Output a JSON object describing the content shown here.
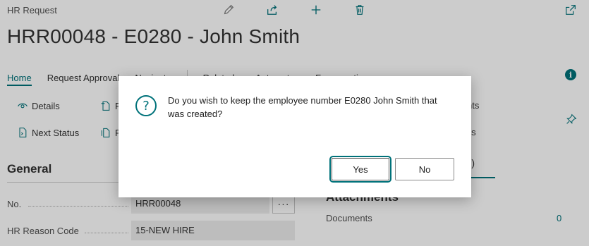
{
  "page": {
    "type_label": "HR Request",
    "title": "HRR00048 - E0280 - John Smith"
  },
  "top_actions": [
    "edit-icon",
    "share-icon",
    "add-icon",
    "delete-icon",
    "expand-icon"
  ],
  "tabs": [
    {
      "label": "Home",
      "active": true
    },
    {
      "label": "Request Approval"
    },
    {
      "label": "Navigate"
    },
    {
      "label": "Related"
    },
    {
      "label": "Automate"
    },
    {
      "label": "Fewer options"
    }
  ],
  "actions": {
    "details": "Details",
    "next_status": "Next Status",
    "p1": "P",
    "p2": "P",
    "right_1": "nts",
    "right_2": "ents"
  },
  "general": {
    "title": "General",
    "fields": [
      {
        "label": "No.",
        "value": "HRR00048"
      },
      {
        "label": "HR Reason Code",
        "value": "15-NEW HIRE"
      }
    ],
    "assist_label": "···"
  },
  "factbox": {
    "tab_label": "s (0)",
    "title": "Attachments",
    "documents_label": "Documents",
    "documents_count": "0"
  },
  "dialog": {
    "message": "Do you wish to keep the employee number E0280 John Smith that was created?",
    "yes_label": "Yes",
    "no_label": "No"
  },
  "colors": {
    "accent": "#00727a",
    "overlay": "rgba(0,0,0,0.2)"
  }
}
